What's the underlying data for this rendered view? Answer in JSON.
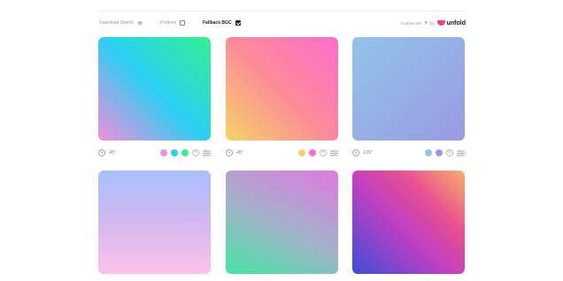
{
  "toolbar": {
    "download_sketch": "Download Sketch",
    "prefixes": "Prefixes",
    "fallback_bgc": "Fallback BGC",
    "prefixes_checked": false,
    "fallback_checked": true
  },
  "credit": {
    "text": "Crafted with",
    "by": "by",
    "brand": "unfold",
    "icon": "heart-icon"
  },
  "cards": [
    {
      "angle": "45°",
      "swatches": [
        "#f28ddc",
        "#2ad0f4",
        "#34f08f"
      ]
    },
    {
      "angle": "45°",
      "swatches": [
        "#f6d365",
        "#fd6fcb"
      ]
    },
    {
      "angle": "135°",
      "swatches": [
        "#92c4e8",
        "#9a9ae4"
      ]
    },
    {
      "angle": "",
      "swatches": []
    },
    {
      "angle": "",
      "swatches": []
    },
    {
      "angle": "",
      "swatches": []
    }
  ]
}
